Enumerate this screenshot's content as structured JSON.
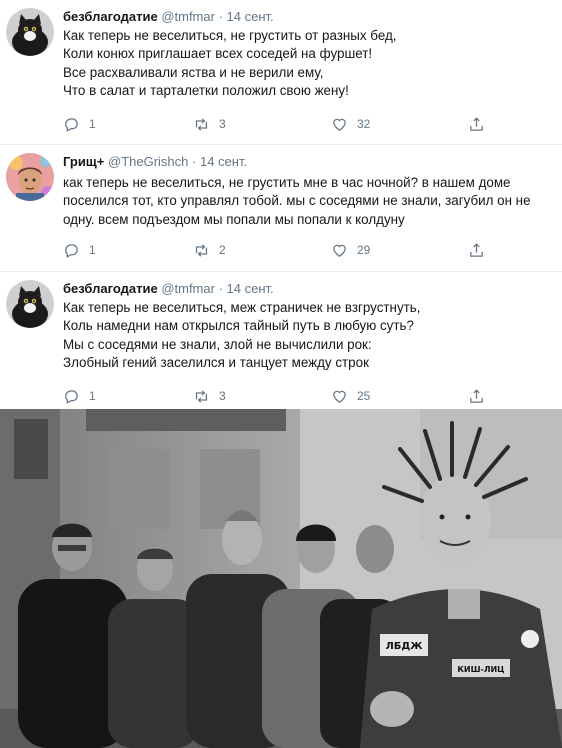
{
  "tweets": [
    {
      "name": "безблагодатие",
      "handle": "@tmfmar",
      "separator": "·",
      "date": "14 сент.",
      "lines": [
        "Как теперь не веселиться, не грустить от разных бед,",
        "Коли конюх приглашает всех соседей на фуршет!",
        "Все расхваливали яства и не верили ему,",
        "Что в салат и тарталетки положил свою жену!"
      ],
      "replies": "1",
      "retweets": "3",
      "likes": "32"
    },
    {
      "name": "Грищ+",
      "handle": "@TheGrishch",
      "separator": "·",
      "date": "14 сент.",
      "text": "как теперь не веселиться, не грустить мне в час ночной? в нашем доме поселился тот, кто управлял тобой. мы с соседями не знали, загубил он не одну. всем подъездом мы попали мы попали к колдуну",
      "replies": "1",
      "retweets": "2",
      "likes": "29"
    },
    {
      "name": "безблагодатие",
      "handle": "@tmfmar",
      "separator": "·",
      "date": "14 сент.",
      "lines": [
        "Как теперь не веселиться, меж страничек не взгрустнуть,",
        "Коль намедни нам открылся тайный путь в любую суть?",
        "Мы с соседями не знали, злой не вычислили рок:",
        "Злобный гений заселился и танцует между строк"
      ],
      "replies": "1",
      "retweets": "3",
      "likes": "25"
    }
  ],
  "photo": {
    "badge_left": "ЛБДЖ",
    "badge_right": "КИШ-ЛИЦ"
  },
  "icons": {
    "reply": "reply-icon",
    "retweet": "retweet-icon",
    "like": "heart-icon",
    "share": "share-icon"
  },
  "colors": {
    "text": "#14171a",
    "muted": "#657786",
    "divider": "#e6ecf0"
  }
}
